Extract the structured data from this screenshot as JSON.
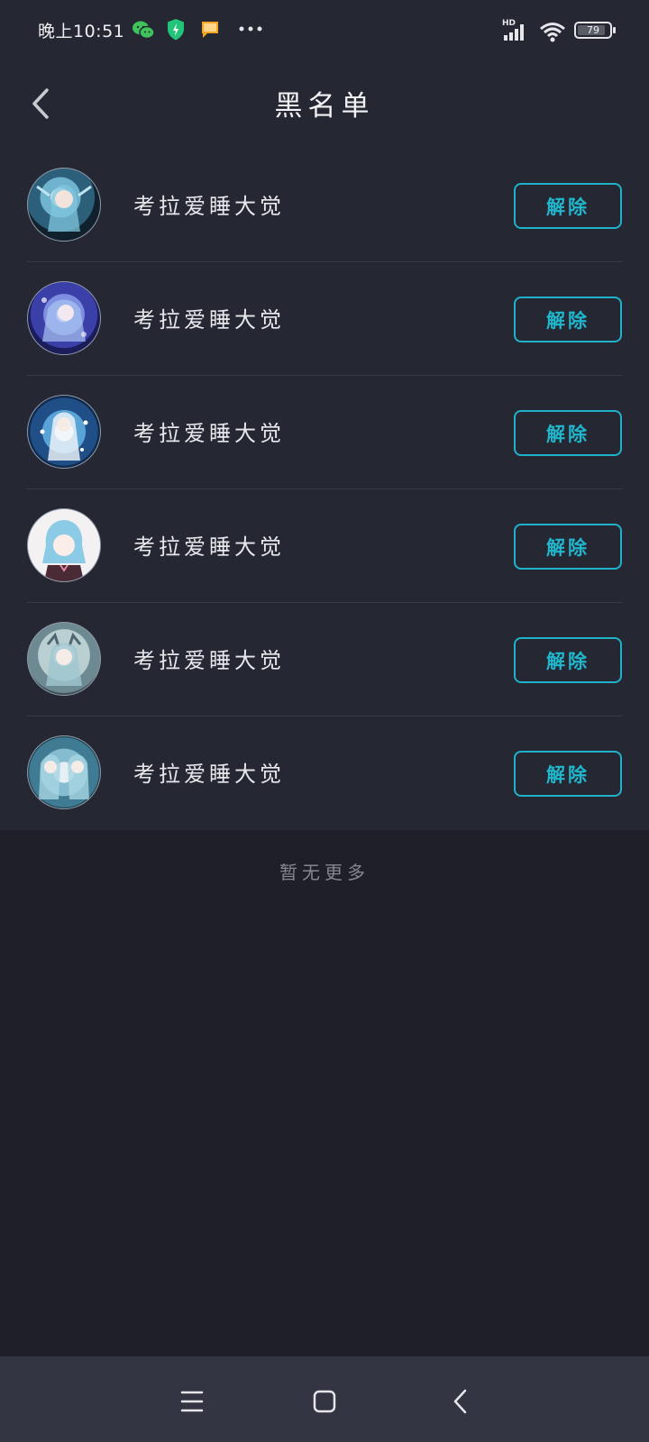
{
  "status_bar": {
    "time": "晚上10:51",
    "battery": "79",
    "network": "HD"
  },
  "header": {
    "title": "黑名单"
  },
  "blacklist": {
    "items": [
      {
        "name": "考拉爱睡大觉",
        "action_label": "解除"
      },
      {
        "name": "考拉爱睡大觉",
        "action_label": "解除"
      },
      {
        "name": "考拉爱睡大觉",
        "action_label": "解除"
      },
      {
        "name": "考拉爱睡大觉",
        "action_label": "解除"
      },
      {
        "name": "考拉爱睡大觉",
        "action_label": "解除"
      },
      {
        "name": "考拉爱睡大觉",
        "action_label": "解除"
      }
    ],
    "footer_text": "暂无更多"
  },
  "colors": {
    "background": "#1f1f29",
    "surface": "#252733",
    "accent": "#20b6cc",
    "navbar": "#343543"
  },
  "icons": {
    "status": [
      "wechat-icon",
      "shield-icon",
      "message-icon",
      "more-icon",
      "signal-icon",
      "wifi-icon",
      "battery-icon"
    ],
    "header": "back-chevron-icon",
    "navigation": [
      "menu-icon",
      "home-icon",
      "back-icon"
    ]
  }
}
